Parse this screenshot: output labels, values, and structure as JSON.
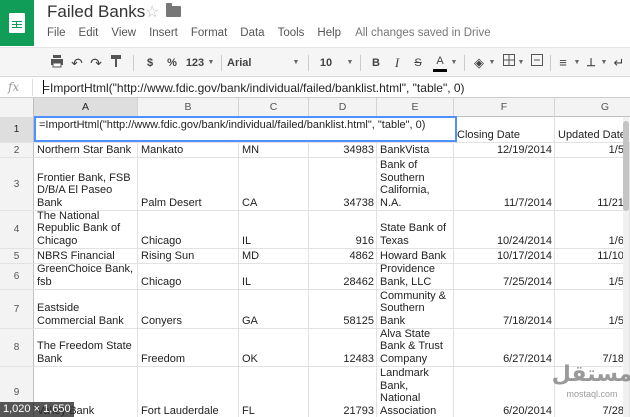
{
  "app": {
    "title": "Failed Banks",
    "save_status": "All changes saved in Drive",
    "menu": [
      "File",
      "Edit",
      "View",
      "Insert",
      "Format",
      "Data",
      "Tools",
      "Help"
    ]
  },
  "toolbar": {
    "currency": "$",
    "percent": "%",
    "more_formats": "123",
    "font": "Arial",
    "font_size": "10",
    "bold": "B",
    "italic": "I",
    "strike": "S",
    "text_color": "A"
  },
  "formula_bar": {
    "fx": "fx",
    "formula": "=ImportHtml(\"http://www.fdic.gov/bank/individual/failed/banklist.html\", \"table\", 0)"
  },
  "grid": {
    "columns": [
      "A",
      "B",
      "C",
      "D",
      "E",
      "F",
      "G"
    ],
    "active_cell_text": "=ImportHtml(\"http://www.fdic.gov/bank/individual/failed/banklist.html\", \"table\", 0)",
    "rows": [
      {
        "num": "1",
        "cells": [
          "",
          "",
          "",
          "",
          "",
          "Closing Date",
          "Updated Date"
        ]
      },
      {
        "num": "2",
        "cells": [
          "Northern Star Bank",
          "Mankato",
          "MN",
          "34983",
          "BankVista",
          "12/19/2014",
          "1/5/"
        ]
      },
      {
        "num": "3",
        "cells": [
          "Frontier Bank, FSB\nD/B/A El Paseo\nBank",
          "Palm Desert",
          "CA",
          "34738",
          "Bank of\nSouthern\nCalifornia,\nN.A.",
          "11/7/2014",
          "11/21/"
        ]
      },
      {
        "num": "4",
        "cells": [
          "The National\nRepublic Bank of\nChicago",
          "Chicago",
          "IL",
          "916",
          "State Bank of\nTexas",
          "10/24/2014",
          "1/6/"
        ]
      },
      {
        "num": "5",
        "cells": [
          "NBRS Financial",
          "Rising Sun",
          "MD",
          "4862",
          "Howard Bank",
          "10/17/2014",
          "11/10/"
        ]
      },
      {
        "num": "6",
        "cells": [
          "GreenChoice Bank,\nfsb",
          "Chicago",
          "IL",
          "28462",
          "Providence\nBank, LLC",
          "7/25/2014",
          "1/5/"
        ]
      },
      {
        "num": "7",
        "cells": [
          "Eastside\nCommercial Bank",
          "Conyers",
          "GA",
          "58125",
          "Community &\nSouthern\nBank",
          "7/18/2014",
          "1/5/"
        ]
      },
      {
        "num": "8",
        "cells": [
          "The Freedom State\nBank",
          "Freedom",
          "OK",
          "12483",
          "Alva State\nBank & Trust\nCompany",
          "6/27/2014",
          "7/18/"
        ]
      },
      {
        "num": "9",
        "cells": [
          "Valley Bank",
          "Fort Lauderdale",
          "FL",
          "21793",
          "Landmark\nBank,\nNational\nAssociation",
          "6/20/2014",
          "7/28/"
        ]
      }
    ]
  },
  "overlays": {
    "dimension_label": "1,020 × 1,650",
    "watermark_main": "مستقل",
    "watermark_sub": "mostaql.com"
  },
  "colors": {
    "brand": "#0f9d58",
    "selection": "#4d90fe"
  }
}
